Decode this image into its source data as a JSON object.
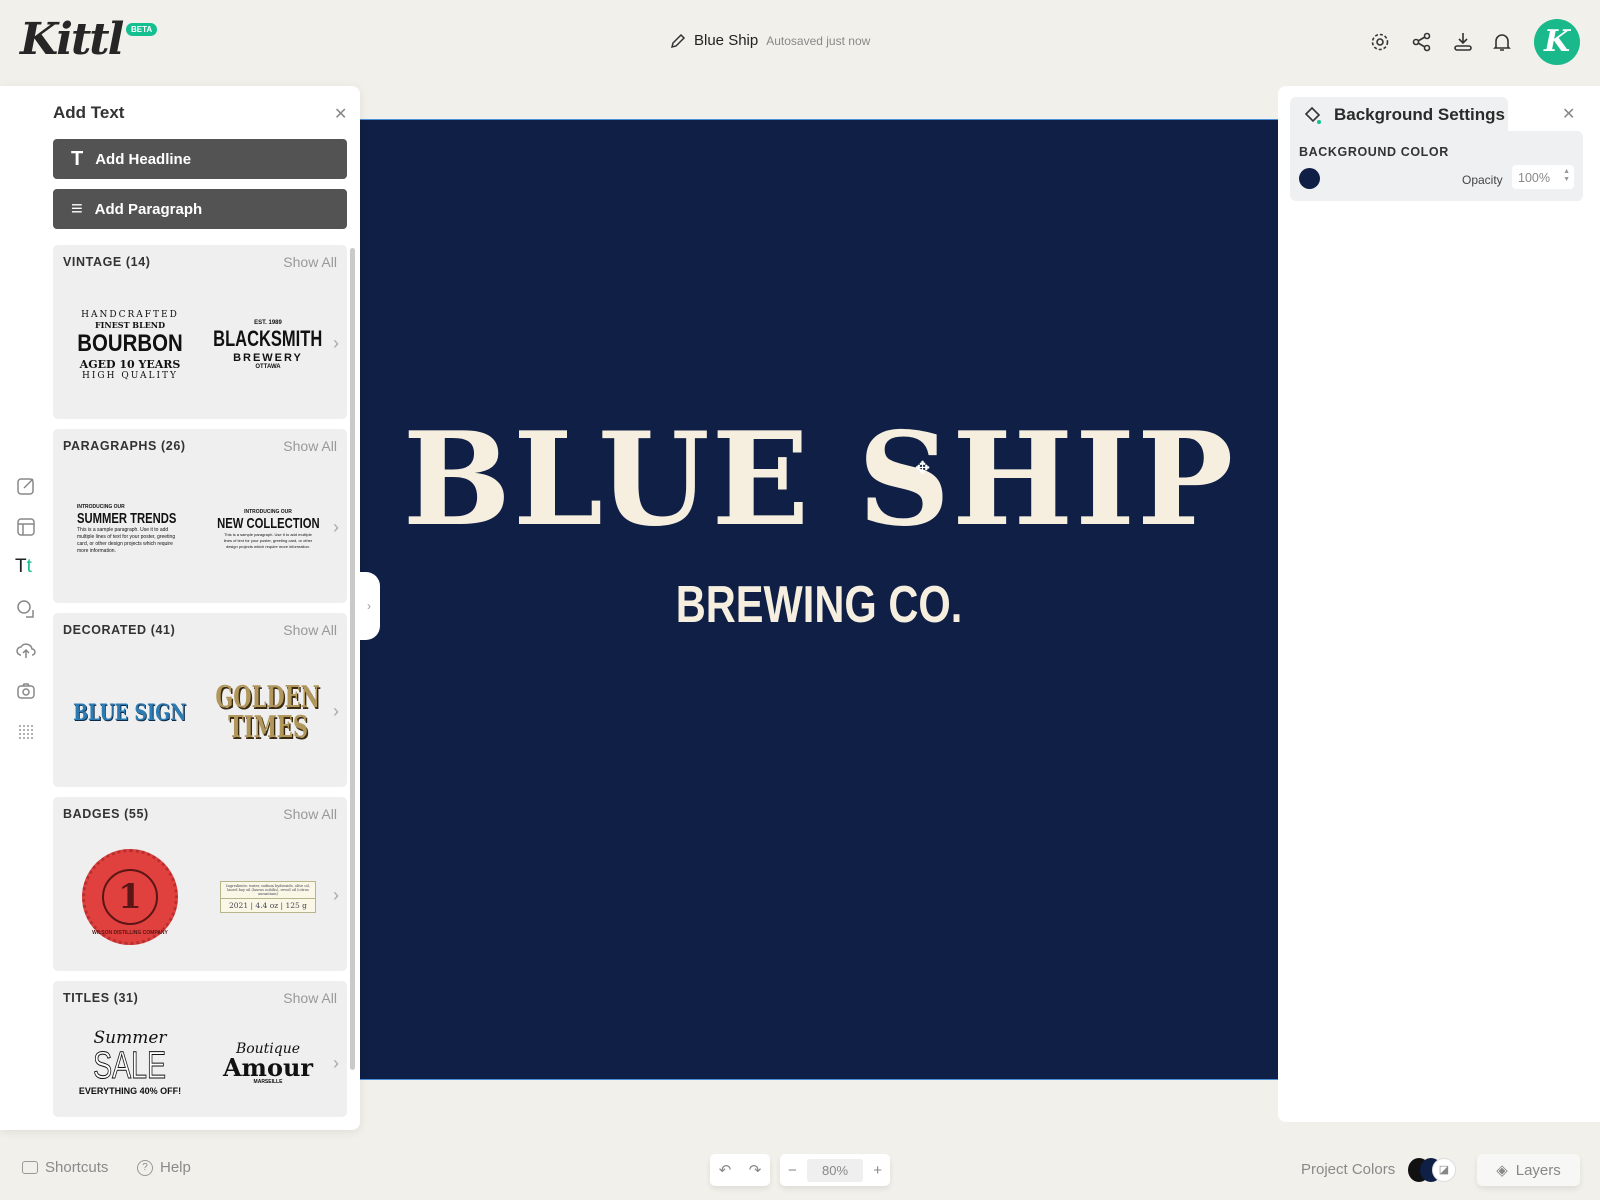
{
  "app": {
    "logo": "Kittl",
    "badge": "BETA"
  },
  "header": {
    "project_name": "Blue Ship",
    "save_status": "Autosaved just now",
    "avatar_letter": "K",
    "icons": [
      "settings-icon",
      "share-icon",
      "download-icon",
      "bell-icon"
    ]
  },
  "left_panel": {
    "title": "Add Text",
    "add_headline": "Add Headline",
    "add_paragraph": "Add Paragraph",
    "categories": [
      {
        "label": "VINTAGE (14)",
        "show_all": "Show All",
        "thumb1": {
          "top": "HANDCRAFTED",
          "sub": "FINEST BLEND",
          "main": "BOURBON",
          "line": "AGED 10 YEARS",
          "bottom": "HIGH QUALITY"
        },
        "thumb2": {
          "top": "EST. 1989",
          "main": "BLACKSMITH",
          "sub": "BREWERY",
          "bottom": "OTTAWA"
        }
      },
      {
        "label": "PARAGRAPHS (26)",
        "show_all": "Show All",
        "thumb1": {
          "top": "INTRODUCING OUR",
          "main": "SUMMER TRENDS",
          "body": "This is a sample paragraph. Use it to add multiple lines of text for your poster, greeting card, or other design projects which require more information."
        },
        "thumb2": {
          "top": "INTRODUCING OUR",
          "main": "NEW COLLECTION",
          "body": "This is a sample paragraph. Use it to add multiple lines of text for your poster, greeting card, or other design projects which require more information."
        }
      },
      {
        "label": "DECORATED (41)",
        "show_all": "Show All",
        "thumb1": {
          "main": "BLUE SIGN"
        },
        "thumb2": {
          "main": "GOLDEN",
          "sub": "TIMES"
        }
      },
      {
        "label": "BADGES (55)",
        "show_all": "Show All",
        "thumb1": {
          "ring": "WILSON DISTILLING COMPANY",
          "main": "1"
        },
        "thumb2": {
          "body": "Ingredients: water, sodium hydroxide, olive oil, laurel bay oil (laurus nobilis), revoil oil (citrus aurantium)",
          "main": "2021 | 4.4 oz | 125 g"
        }
      },
      {
        "label": "TITLES (31)",
        "show_all": "Show All",
        "thumb1": {
          "script": "Summer",
          "main": "SALE",
          "bottom": "EVERYTHING 40% OFF!"
        },
        "thumb2": {
          "script": "Boutique",
          "main": "Amour",
          "bottom": "MARSEILLE"
        }
      }
    ],
    "rail_icons": [
      "edit-icon",
      "templates-icon",
      "text-icon",
      "shapes-icon",
      "upload-icon",
      "camera-icon",
      "pattern-icon"
    ],
    "rail_text_icon": "Tt"
  },
  "canvas": {
    "headline": "BLUE SHIP",
    "subline": "BREWING CO.",
    "background_color": "#0f1f45",
    "text_color": "#f6efdf"
  },
  "right_panel": {
    "title": "Background Settings",
    "section": "BACKGROUND COLOR",
    "color": "#0f1f45",
    "opacity_label": "Opacity",
    "opacity_value": "100%"
  },
  "footer": {
    "shortcuts": "Shortcuts",
    "help": "Help",
    "zoom": "80%",
    "zoom_minus": "−",
    "zoom_plus": "+",
    "project_colors": "Project Colors",
    "layers": "Layers",
    "colors": [
      "#111111",
      "#0f1f45"
    ]
  },
  "accent": "#14c08f"
}
